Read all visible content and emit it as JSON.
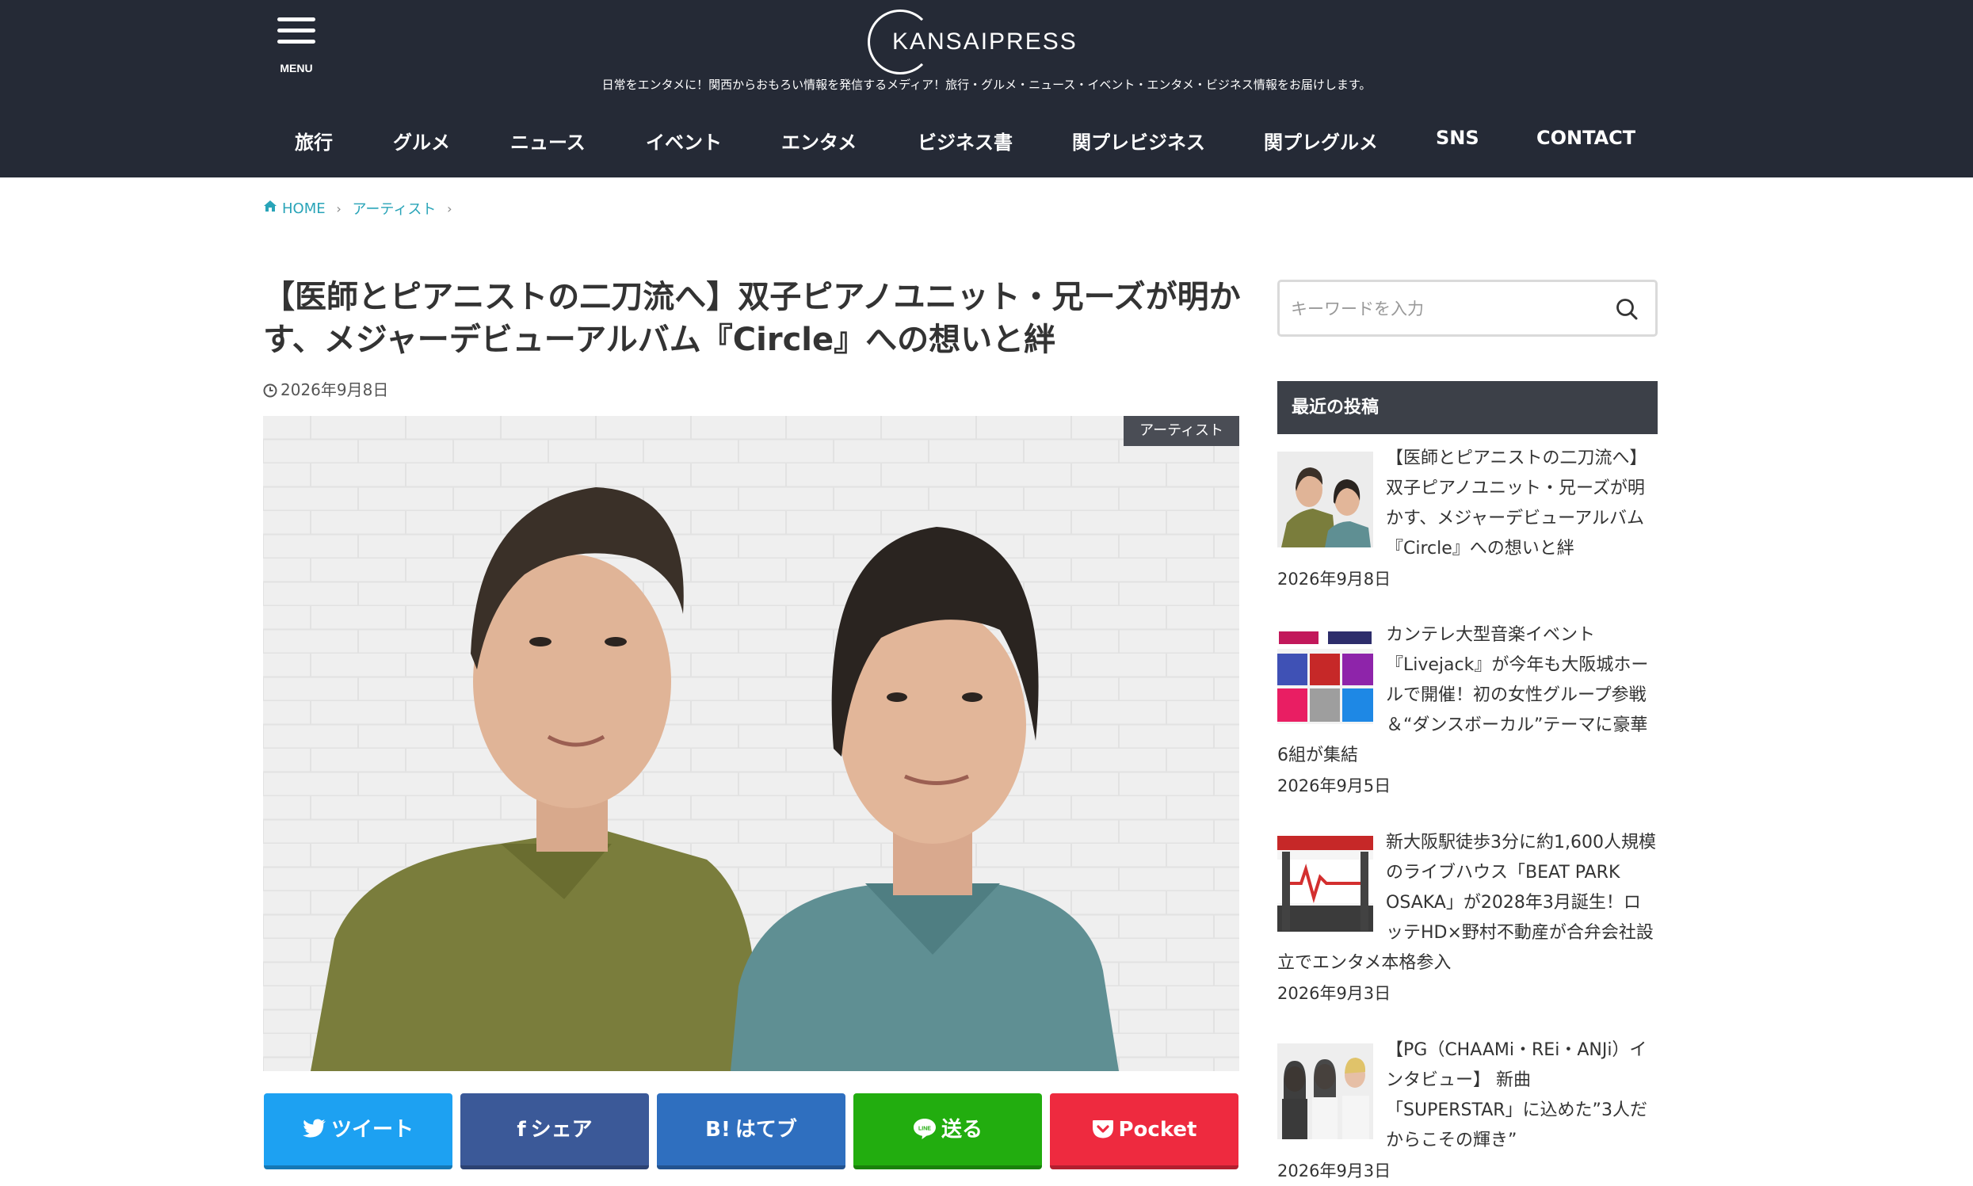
{
  "site": {
    "logo_text": "KANSAIPRESS",
    "menu_label": "MENU",
    "tagline": "日常をエンタメに！関西からおもろい情報を発信するメディア！旅行・グルメ・ニュース・イベント・エンタメ・ビジネス情報をお届けします。"
  },
  "nav": [
    "旅行",
    "グルメ",
    "ニュース",
    "イベント",
    "エンタメ",
    "ビジネス書",
    "関プレビジネス",
    "関プレグルメ",
    "SNS",
    "CONTACT"
  ],
  "breadcrumb": [
    "HOME",
    "アーティスト"
  ],
  "article": {
    "title": "【医師とピアニストの二刀流へ】双子ピアノユニット・兄ーズが明かす、メジャーデビューアルバム『Circle』への想いと絆",
    "date": "2026年9月8日",
    "category": "アーティスト"
  },
  "share": [
    {
      "label": "ツイート",
      "icon": "twitter-bird-icon",
      "color": "#1da1f2"
    },
    {
      "label": "シェア",
      "icon": "facebook-f-icon",
      "color": "#3b5998"
    },
    {
      "label": "はてブ",
      "icon": "hatena-b-icon",
      "color": "#2f6fbf"
    },
    {
      "label": "送る",
      "icon": "line-icon",
      "color": "#22ad0f"
    },
    {
      "label": "Pocket",
      "icon": "pocket-icon",
      "color": "#ee2a3f"
    }
  ],
  "sidebar": {
    "search_placeholder": "キーワードを入力",
    "recent_heading": "最近の投稿",
    "posts": [
      {
        "title": "【医師とピアニストの二刀流へ】双子ピアノユニット・兄ーズが明かす、メジャーデビューアルバム『Circle』への想いと絆",
        "date": "2026年9月8日"
      },
      {
        "title": "カンテレ大型音楽イベント『Livejack』が今年も大阪城ホールで開催！初の女性グループ参戦＆“ダンスボーカル”テーマに豪華6組が集結",
        "date": "2026年9月5日"
      },
      {
        "title": "新大阪駅徒歩3分に約1,600人規模のライブハウス「BEAT PARK OSAKA」が2028年3月誕生！ロッテHD×野村不動産が合弁会社設立でエンタメ本格参入",
        "date": "2026年9月3日"
      },
      {
        "title": "【PG（CHAAMi・REi・ANJi）インタビュー】 新曲「SUPERSTAR」に込めた”3人だからこその輝き”",
        "date": "2026年9月3日"
      }
    ]
  }
}
